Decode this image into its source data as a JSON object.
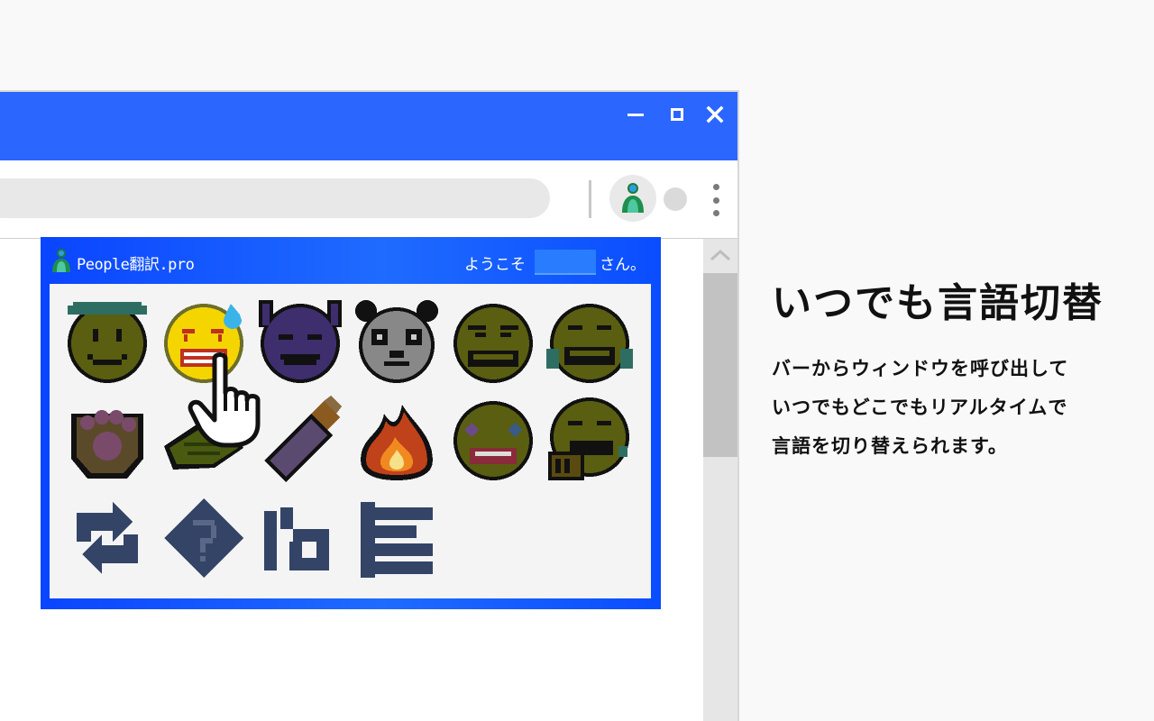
{
  "popup": {
    "title": "People翻訳.pro",
    "welcome": "ようこそ",
    "suffix": "さん。"
  },
  "emojis": [
    {
      "name": "smiley-mustache-emoji"
    },
    {
      "name": "sweat-grin-emoji"
    },
    {
      "name": "devil-smile-emoji"
    },
    {
      "name": "panda-emoji"
    },
    {
      "name": "grimace-emoji"
    },
    {
      "name": "crying-laugh-emoji"
    },
    {
      "name": "paw-emoji"
    },
    {
      "name": "leaf-emoji"
    },
    {
      "name": "baby-bottle-emoji"
    },
    {
      "name": "fire-emoji"
    },
    {
      "name": "clown-emoji"
    },
    {
      "name": "pointing-laugh-emoji"
    }
  ],
  "controls": [
    {
      "name": "refresh-icon"
    },
    {
      "name": "help-diamond-icon"
    },
    {
      "name": "language-switch-icon"
    },
    {
      "name": "menu-lines-icon"
    }
  ],
  "feature": {
    "headline": "いつでも言語切替",
    "lines": [
      "バーからウィンドウを呼び出して",
      "いつでもどこでもリアルタイムで",
      "言語を切り替えられます。"
    ]
  },
  "colors": {
    "titlebar": "#2a66ff",
    "popup": "#0a45ff",
    "icon": "#334466"
  }
}
